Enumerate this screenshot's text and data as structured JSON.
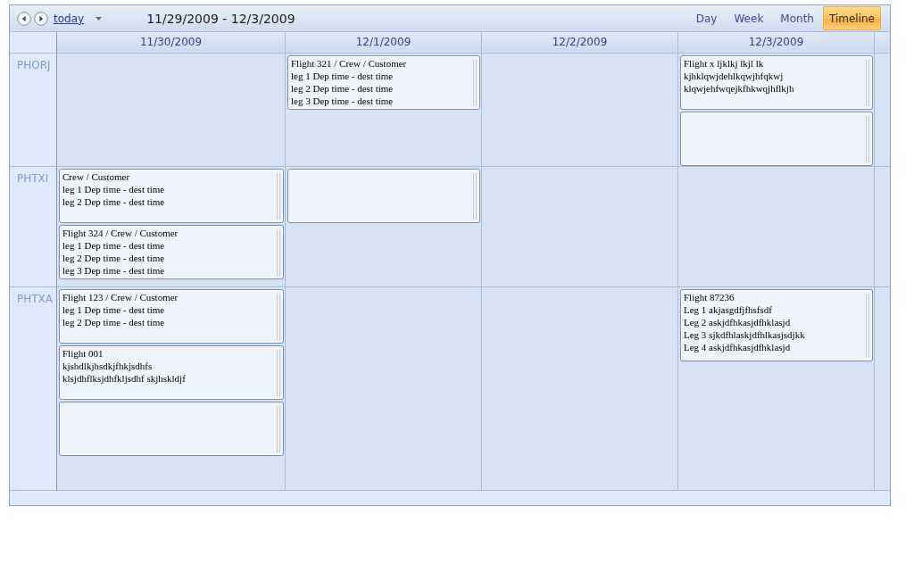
{
  "toolbar": {
    "today_link": "today",
    "date_range": "11/29/2009 - 12/3/2009",
    "views": [
      {
        "label": "Day",
        "selected": false
      },
      {
        "label": "Week",
        "selected": false
      },
      {
        "label": "Month",
        "selected": false
      },
      {
        "label": "Timeline",
        "selected": true
      }
    ]
  },
  "columns": [
    "11/30/2009",
    "12/1/2009",
    "12/2/2009",
    "12/3/2009"
  ],
  "resources": [
    {
      "name": "PHORJ",
      "column_2": [
        {
          "kind": "text",
          "lines": [
            "Flight 321 / Crew / Customer",
            "leg 1 Dep time - dest time",
            "leg 2 Dep time - dest time",
            "leg 3 Dep time - dest time"
          ]
        }
      ],
      "column_4": [
        {
          "kind": "text",
          "lines": [
            "Flight x ljklkj lkjl lk",
            "kjhklqwjdehlkqwjhfqkwj",
            "klqwjehfwqejkfhkwqjhflkjh"
          ]
        },
        {
          "kind": "empty"
        }
      ]
    },
    {
      "name": "PHTXI",
      "column_1": [
        {
          "kind": "text",
          "lines": [
            "Crew / Customer",
            "leg 1 Dep time - dest time",
            "leg 2 Dep time - dest time"
          ]
        },
        {
          "kind": "text",
          "lines": [
            "Flight 324 / Crew / Customer",
            "leg 1 Dep time - dest time",
            "leg 2 Dep time - dest time",
            "leg 3 Dep time - dest time"
          ]
        }
      ],
      "column_2": [
        {
          "kind": "empty"
        }
      ]
    },
    {
      "name": "PHTXA",
      "column_1": [
        {
          "kind": "text",
          "lines": [
            "Flight 123 / Crew / Customer",
            "leg 1 Dep time - dest time",
            "leg 2 Dep time - dest time"
          ]
        },
        {
          "kind": "text",
          "lines": [
            "Flight 001",
            "kjshdlkjhsdkjfhkjsdhfs",
            "klsjdhflksjdhfkljsdhf skjhskldjf"
          ]
        },
        {
          "kind": "empty"
        }
      ],
      "column_4": [
        {
          "kind": "text",
          "lines": [
            "Flight 87236",
            "Leg 1 akjasgdfjfhsfsdf",
            "Leg 2 askjdfhkasjdfhklasjd",
            "Leg 3 sjkdfhlaskjdfhlkasjsdjkk",
            "Leg 4 askjdfhkasjdfhklasjd"
          ]
        }
      ]
    }
  ]
}
